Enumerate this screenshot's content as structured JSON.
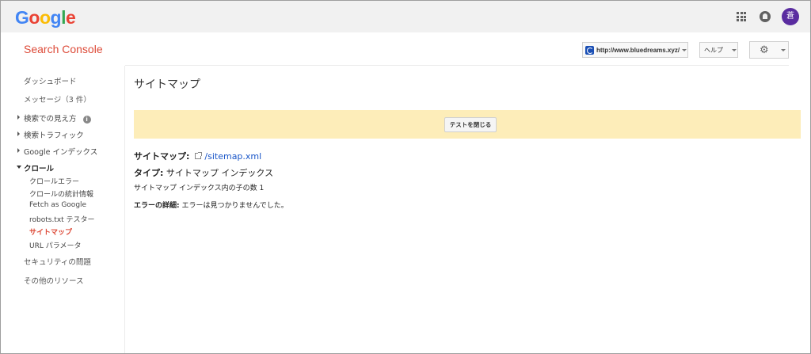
{
  "google_bar": {
    "logo_letters": [
      {
        "char": "G",
        "color": "#4285f4"
      },
      {
        "char": "o",
        "color": "#ea4335"
      },
      {
        "char": "o",
        "color": "#fbbc05"
      },
      {
        "char": "g",
        "color": "#4285f4"
      },
      {
        "char": "l",
        "color": "#34a853"
      },
      {
        "char": "e",
        "color": "#ea4335"
      }
    ],
    "apps_icon": "apps-grid-icon",
    "notifications_icon": "bell-icon",
    "avatar_text": "蒼",
    "avatar_color": "#5a2ca0"
  },
  "header": {
    "app_title": "Search Console",
    "app_title_color": "#dd4b39",
    "site_selector": "http://www.bluedreams.xyz/",
    "help_label": "ヘルプ",
    "settings_icon": "gear-icon"
  },
  "sidebar": {
    "dashboard": "ダッシュボード",
    "messages": "メッセージ（3 件）",
    "search_appearance": "検索での見え方",
    "search_traffic": "検索トラフィック",
    "google_index": "Google インデックス",
    "crawl": "クロール",
    "crawl_items": [
      "クロールエラー",
      "クロールの統計情報",
      "Fetch as Google",
      "robots.txt テスター",
      "サイトマップ",
      "URL パラメータ"
    ],
    "active_item": "サイトマップ",
    "security": "セキュリティの問題",
    "other_resources": "その他のリソース"
  },
  "main": {
    "page_title": "サイトマップ",
    "banner_color": "#fdedb9",
    "close_test_button": "テストを閉じる",
    "sitemap_label": "サイトマップ:",
    "sitemap_link": "/sitemap.xml",
    "type_label": "タイプ:",
    "type_value": "サイトマップ インデックス",
    "child_count_text": "サイトマップ インデックス内の子の数 1",
    "error_label": "エラーの詳細:",
    "error_value": "エラーは見つかりませんでした。"
  }
}
